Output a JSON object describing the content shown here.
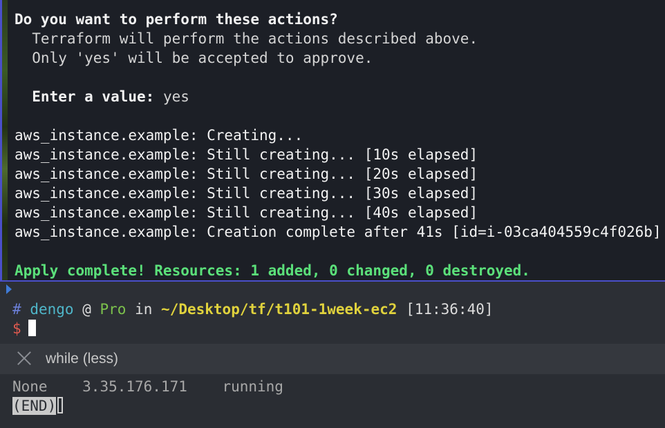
{
  "terraform_output": {
    "lines": [
      {
        "text": "Do you want to perform these actions?",
        "style": "bold"
      },
      {
        "text": "  Terraform will perform the actions described above.",
        "style": "dim"
      },
      {
        "text": "  Only 'yes' will be accepted to approve.",
        "style": "dim"
      },
      {
        "text": "",
        "style": "normal"
      },
      {
        "text_bold": "  Enter a value:",
        "text_value": " yes",
        "style": "prompt"
      },
      {
        "text": "",
        "style": "normal"
      },
      {
        "text": "aws_instance.example: Creating...",
        "style": "normal"
      },
      {
        "text": "aws_instance.example: Still creating... [10s elapsed]",
        "style": "normal"
      },
      {
        "text": "aws_instance.example: Still creating... [20s elapsed]",
        "style": "normal"
      },
      {
        "text": "aws_instance.example: Still creating... [30s elapsed]",
        "style": "normal"
      },
      {
        "text": "aws_instance.example: Still creating... [40s elapsed]",
        "style": "normal"
      },
      {
        "text": "aws_instance.example: Creation complete after 41s [id=i-03ca404559c4f026b]",
        "style": "normal"
      },
      {
        "text": "",
        "style": "normal"
      },
      {
        "text": "Apply complete! Resources: 1 added, 0 changed, 0 destroyed.",
        "style": "green"
      }
    ]
  },
  "prompt": {
    "hash": "#",
    "user": "dengo",
    "at": "@",
    "host": "Pro",
    "in": "in",
    "path": "~/Desktop/tf/t101-1week-ec2",
    "time": "[11:36:40]",
    "dollar": "$"
  },
  "less_pane": {
    "title": "while (less)",
    "row": {
      "col1": "None",
      "col2": "3.35.176.171",
      "col3": "running"
    },
    "end_label": "(END)"
  },
  "colors": {
    "pane_border": "#4a4fc9",
    "success_green": "#5be07a",
    "path_yellow": "#e0d23d",
    "host_green": "#7cc24c",
    "user_cyan": "#4fb6c9",
    "dollar_red": "#e05a4f"
  },
  "icons": {
    "close": "close-icon",
    "pane_marker": "pane-marker-icon"
  }
}
